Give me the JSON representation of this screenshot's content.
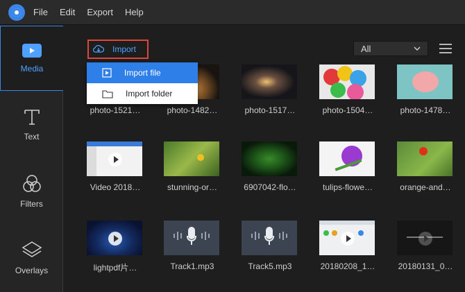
{
  "menubar": {
    "items": [
      "File",
      "Edit",
      "Export",
      "Help"
    ]
  },
  "sidebar": {
    "items": [
      {
        "label": "Media",
        "icon": "media-icon",
        "active": true
      },
      {
        "label": "Text",
        "icon": "text-icon"
      },
      {
        "label": "Filters",
        "icon": "filters-icon"
      },
      {
        "label": "Overlays",
        "icon": "overlays-icon"
      }
    ]
  },
  "toolbar": {
    "import_label": "Import",
    "filter_value": "All"
  },
  "import_menu": {
    "items": [
      "Import file",
      "Import folder"
    ]
  },
  "media": {
    "items": [
      {
        "caption": "photo-1521…",
        "kind": "photo"
      },
      {
        "caption": "photo-1482…",
        "kind": "photo"
      },
      {
        "caption": "photo-1517…",
        "kind": "photo"
      },
      {
        "caption": "photo-1504…",
        "kind": "photo"
      },
      {
        "caption": "photo-1478…",
        "kind": "photo"
      },
      {
        "caption": "Video 2018…",
        "kind": "video"
      },
      {
        "caption": "stunning-or…",
        "kind": "photo"
      },
      {
        "caption": "6907042-flo…",
        "kind": "photo"
      },
      {
        "caption": "tulips-flowe…",
        "kind": "photo"
      },
      {
        "caption": "orange-and…",
        "kind": "photo"
      },
      {
        "caption": "lightpdf片…",
        "kind": "video"
      },
      {
        "caption": "Track1.mp3",
        "kind": "audio"
      },
      {
        "caption": "Track5.mp3",
        "kind": "audio"
      },
      {
        "caption": "20180208_1…",
        "kind": "video"
      },
      {
        "caption": "20180131_0…",
        "kind": "video"
      }
    ]
  },
  "colors": {
    "accent": "#4ea1ff",
    "highlight_border": "#e0473b",
    "menu_selected": "#2f7fe8"
  }
}
